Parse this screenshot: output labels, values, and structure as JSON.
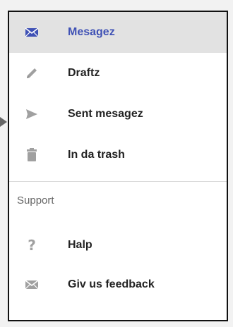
{
  "nav": {
    "items": [
      {
        "label": "Mesagez",
        "icon": "mail-icon",
        "active": true
      },
      {
        "label": "Draftz",
        "icon": "pencil-icon",
        "active": false
      },
      {
        "label": "Sent mesagez",
        "icon": "send-icon",
        "active": false
      },
      {
        "label": "In da trash",
        "icon": "trash-icon",
        "active": false
      }
    ]
  },
  "support": {
    "header": "Support",
    "items": [
      {
        "label": "Halp",
        "icon": "help-icon"
      },
      {
        "label": "Giv us feedback",
        "icon": "feedback-mail-icon"
      }
    ]
  },
  "colors": {
    "accent": "#3f51b5",
    "active_bg": "#e2e2e2",
    "icon_gray": "#a0a0a0",
    "text": "#222222"
  }
}
